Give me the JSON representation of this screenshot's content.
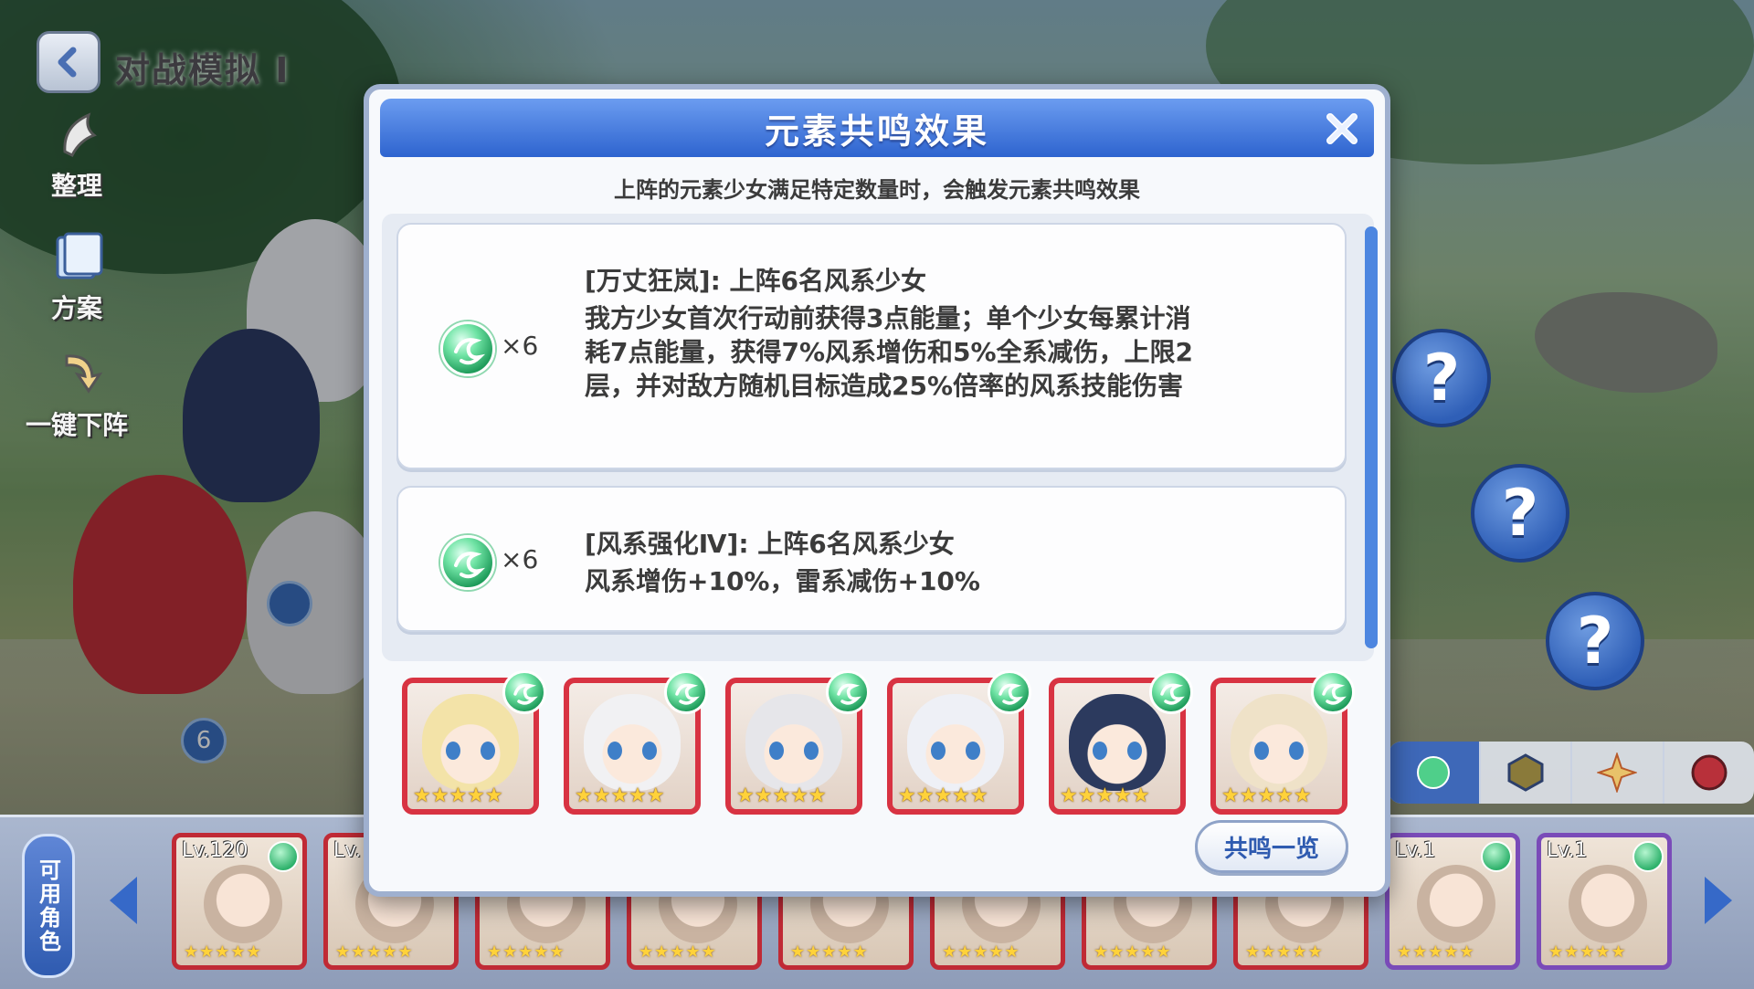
{
  "top": {
    "title": "对战模拟 I",
    "tools": [
      {
        "label": "整理",
        "icon": "broom-icon"
      },
      {
        "label": "方案",
        "icon": "cards-icon"
      },
      {
        "label": "一键下阵",
        "icon": "down-arrow-icon"
      }
    ]
  },
  "field": {
    "slot_number": "6",
    "unknown_marks": [
      "?",
      "?",
      "?"
    ]
  },
  "dialog": {
    "title": "元素共鸣效果",
    "subtitle": "上阵的元素少女满足特定数量时，会触发元素共鸣效果",
    "entries": [
      {
        "icon": "wind-element-icon",
        "count": "×6",
        "title": "[万丈狂岚]: 上阵6名风系少女",
        "description": "我方少女首次行动前获得3点能量；单个少女每累计消耗7点能量，获得7%风系增伤和5%全系减伤，上限2层，并对敌方随机目标造成25%倍率的风系技能伤害"
      },
      {
        "icon": "wind-element-icon",
        "count": "×6",
        "title": "[风系强化Ⅳ]: 上阵6名风系少女",
        "description": "风系增伤+10%，雷系减伤+10%"
      }
    ],
    "team": [
      {
        "stars": "★★★★★",
        "hair": "#f3e3a8",
        "element": "wind"
      },
      {
        "stars": "★★★★★",
        "hair": "#f1f1f3",
        "element": "wind"
      },
      {
        "stars": "★★★★★",
        "hair": "#e6e6ea",
        "element": "wind"
      },
      {
        "stars": "★★★★★",
        "hair": "#eef0f6",
        "element": "wind"
      },
      {
        "stars": "★★★★★",
        "hair": "#2c3a5e",
        "element": "wind"
      },
      {
        "stars": "★★★★★",
        "hair": "#efe2c8",
        "element": "wind"
      }
    ],
    "resonance_button": "共鸣一览",
    "colors": {
      "header": "#2e64cf",
      "frame": "#d83342",
      "wind": "#1e9b5a"
    }
  },
  "roster": {
    "tab_label": "可用角色",
    "cards": [
      {
        "lv": "Lv.120",
        "stars": "★★★★★"
      },
      {
        "lv": "Lv.",
        "stars": "★★★★★"
      },
      {
        "lv": "",
        "stars": "★★★★★"
      },
      {
        "lv": "",
        "stars": "★★★★★"
      },
      {
        "lv": "",
        "stars": "★★★★★"
      },
      {
        "lv": "",
        "stars": "★★★★★"
      },
      {
        "lv": "",
        "stars": "★★★★★"
      },
      {
        "lv": "",
        "stars": "★★★★★"
      },
      {
        "lv": "Lv.1",
        "stars": "★★★★★"
      },
      {
        "lv": "Lv.1",
        "stars": "★★★★★"
      }
    ]
  },
  "element_tabs": [
    "wind-icon",
    "shield-hex-icon",
    "star-burst-icon",
    "dragon-icon"
  ]
}
